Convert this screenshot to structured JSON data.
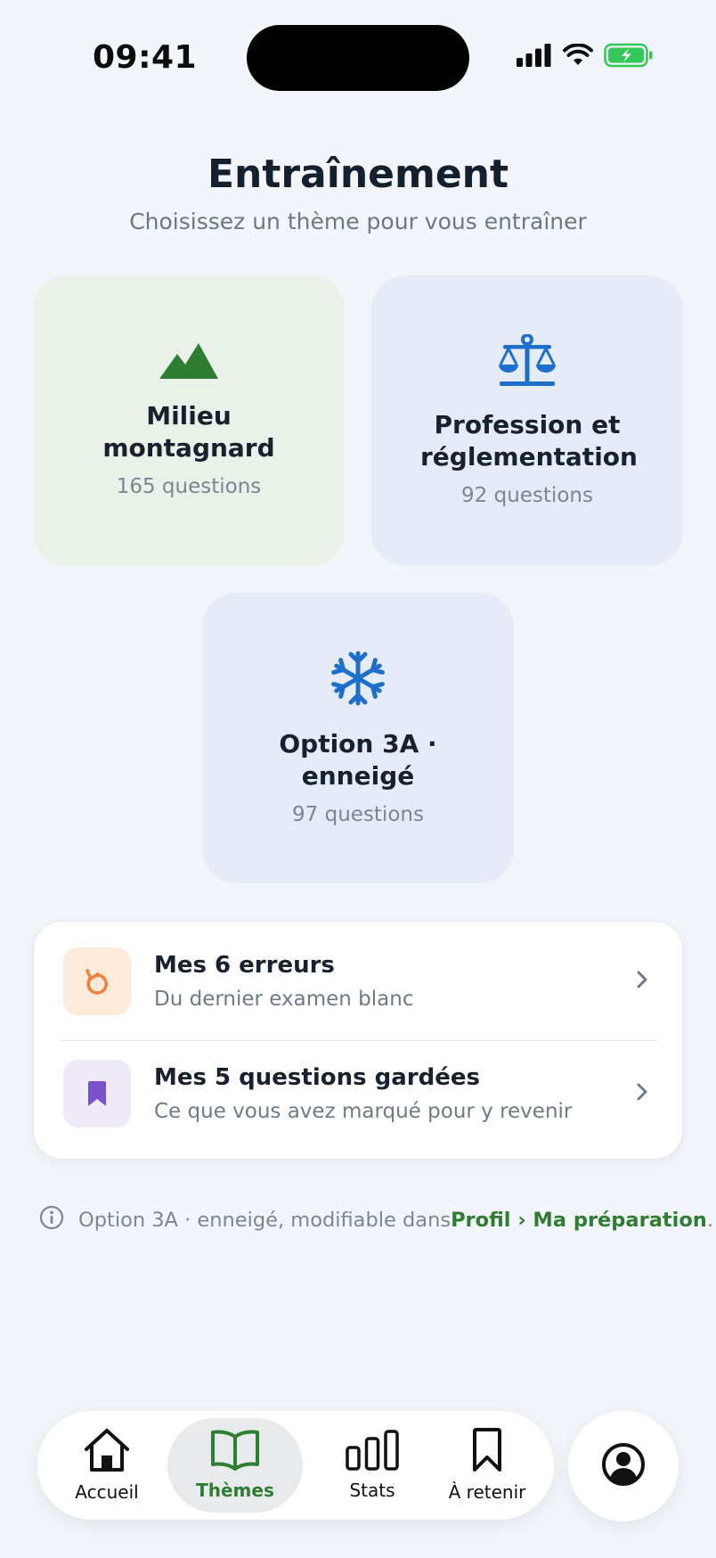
{
  "status_bar": {
    "time": "09:41"
  },
  "header": {
    "title": "Entraînement",
    "subtitle": "Choisissez un thème pour vous entraîner"
  },
  "themes": [
    {
      "title": "Milieu montagnard",
      "count": "165 questions",
      "icon": "mountain-icon",
      "color": "#2e7d32"
    },
    {
      "title": "Profession et réglementation",
      "count": "92 questions",
      "icon": "scale-icon",
      "color": "#1e6fcc"
    },
    {
      "title": "Option 3A · enneigé",
      "count": "97 questions",
      "icon": "snowflake-icon",
      "color": "#1e6fcc"
    }
  ],
  "shortcuts": [
    {
      "title": "Mes 6 erreurs",
      "subtitle": "Du dernier examen blanc",
      "icon": "retry-icon",
      "color": "#f0803c"
    },
    {
      "title": "Mes 5 questions gardées",
      "subtitle": "Ce que vous avez marqué pour y revenir",
      "icon": "bookmark-icon",
      "color": "#7b52c9"
    }
  ],
  "info_note": {
    "text": "Option 3A · enneigé, modifiable dans ",
    "link": "Profil › Ma préparation",
    "suffix": "."
  },
  "bottom_nav": {
    "items": [
      {
        "label": "Accueil",
        "icon": "home-icon"
      },
      {
        "label": "Thèmes",
        "icon": "book-icon",
        "active": true
      },
      {
        "label": "Stats",
        "icon": "stats-icon"
      },
      {
        "label": "À retenir",
        "icon": "bookmark-icon"
      }
    ],
    "profile_icon": "profile-icon"
  },
  "colors": {
    "accent": "#2e7d32",
    "background": "#f2f6fa"
  }
}
